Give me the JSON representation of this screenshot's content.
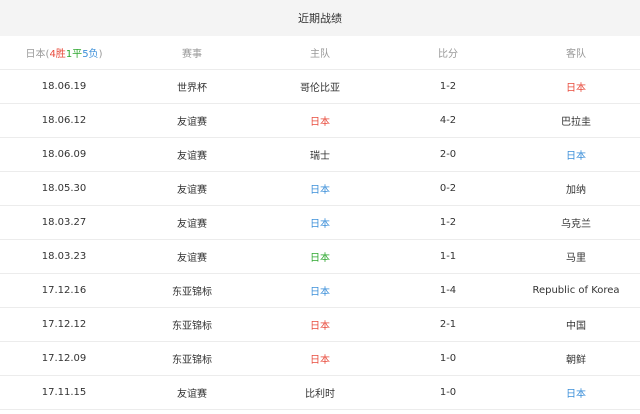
{
  "title": "近期战绩",
  "header": {
    "team": "日本",
    "paren_open": "(",
    "wins": "4胜",
    "draws": "1平",
    "losses": "5负",
    "paren_close": ")",
    "competition": "赛事",
    "home": "主队",
    "score": "比分",
    "away": "客队"
  },
  "colors": {
    "win": "#e84c3d",
    "draw": "#2ea830",
    "loss": "#3b8fd9",
    "text": "#333333"
  },
  "matches": [
    {
      "date": "18.06.19",
      "competition": "世界杯",
      "home": "哥伦比亚",
      "home_color": "dark",
      "score": "1-2",
      "away": "日本",
      "away_color": "red"
    },
    {
      "date": "18.06.12",
      "competition": "友谊赛",
      "home": "日本",
      "home_color": "red",
      "score": "4-2",
      "away": "巴拉圭",
      "away_color": "dark"
    },
    {
      "date": "18.06.09",
      "competition": "友谊赛",
      "home": "瑞士",
      "home_color": "dark",
      "score": "2-0",
      "away": "日本",
      "away_color": "blue"
    },
    {
      "date": "18.05.30",
      "competition": "友谊赛",
      "home": "日本",
      "home_color": "blue",
      "score": "0-2",
      "away": "加纳",
      "away_color": "dark"
    },
    {
      "date": "18.03.27",
      "competition": "友谊赛",
      "home": "日本",
      "home_color": "blue",
      "score": "1-2",
      "away": "乌克兰",
      "away_color": "dark"
    },
    {
      "date": "18.03.23",
      "competition": "友谊赛",
      "home": "日本",
      "home_color": "green",
      "score": "1-1",
      "away": "马里",
      "away_color": "dark"
    },
    {
      "date": "17.12.16",
      "competition": "东亚锦标",
      "home": "日本",
      "home_color": "blue",
      "score": "1-4",
      "away": "Republic of Korea",
      "away_color": "dark"
    },
    {
      "date": "17.12.12",
      "competition": "东亚锦标",
      "home": "日本",
      "home_color": "red",
      "score": "2-1",
      "away": "中国",
      "away_color": "dark"
    },
    {
      "date": "17.12.09",
      "competition": "东亚锦标",
      "home": "日本",
      "home_color": "red",
      "score": "1-0",
      "away": "朝鲜",
      "away_color": "dark"
    },
    {
      "date": "17.11.15",
      "competition": "友谊赛",
      "home": "比利时",
      "home_color": "dark",
      "score": "1-0",
      "away": "日本",
      "away_color": "blue"
    }
  ]
}
